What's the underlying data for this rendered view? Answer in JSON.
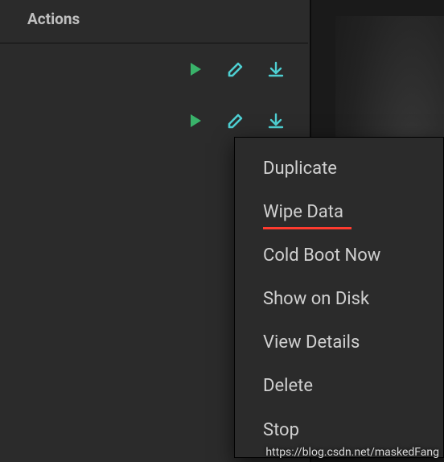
{
  "header": {
    "title": "Actions"
  },
  "rows": [
    {
      "icons": [
        "play",
        "edit",
        "download"
      ]
    },
    {
      "icons": [
        "play",
        "edit",
        "download"
      ]
    }
  ],
  "menu": {
    "items": [
      {
        "label": "Duplicate",
        "highlight": false
      },
      {
        "label": "Wipe Data",
        "highlight": true
      },
      {
        "label": "Cold Boot Now",
        "highlight": false
      },
      {
        "label": "Show on Disk",
        "highlight": false
      },
      {
        "label": "View Details",
        "highlight": false
      },
      {
        "label": "Delete",
        "highlight": false
      },
      {
        "label": "Stop",
        "highlight": false
      }
    ]
  },
  "watermark": "https://blog.csdn.net/maskedFang",
  "colors": {
    "play": "#39b36a",
    "edit": "#4ecfd2",
    "download": "#4ecfd2"
  }
}
